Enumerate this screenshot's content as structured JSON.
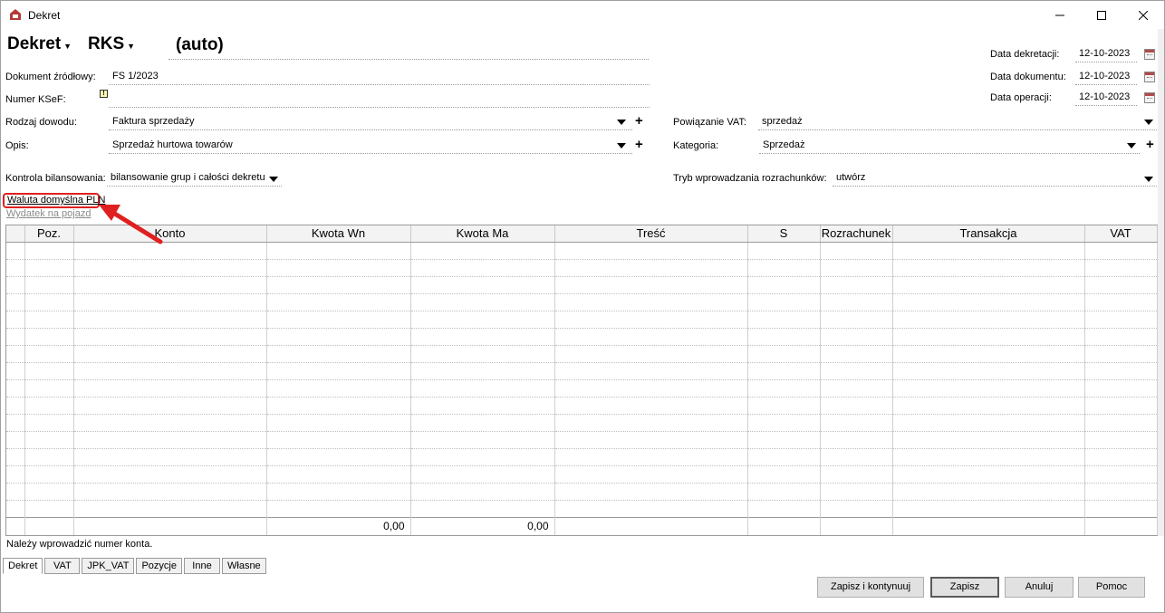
{
  "window": {
    "title": "Dekret"
  },
  "header": {
    "type_label": "Dekret",
    "register_label": "RKS",
    "number_value": "(auto)"
  },
  "dates": {
    "dekretacji_label": "Data dekretacji:",
    "dekretacji_value": "12-10-2023",
    "dokumentu_label": "Data dokumentu:",
    "dokumentu_value": "12-10-2023",
    "operacji_label": "Data operacji:",
    "operacji_value": "12-10-2023"
  },
  "fields": {
    "dokument_label": "Dokument źródłowy:",
    "dokument_value": "FS 1/2023",
    "ksef_label": "Numer KSeF:",
    "ksef_value": "",
    "rodzaj_label": "Rodzaj dowodu:",
    "rodzaj_value": "Faktura sprzedaży",
    "opis_label": "Opis:",
    "opis_value": "Sprzedaż hurtowa towarów",
    "kontrola_label": "Kontrola bilansowania:",
    "kontrola_value": "bilansowanie grup i całości dekretu",
    "powiazanie_label": "Powiązanie VAT:",
    "powiazanie_value": "sprzedaż",
    "kategoria_label": "Kategoria:",
    "kategoria_value": "Sprzedaż",
    "tryb_label": "Tryb wprowadzania rozrachunków:",
    "tryb_value": "utwórz"
  },
  "links": {
    "waluta": "Waluta domyślna PLN",
    "wydatek": "Wydatek na pojazd"
  },
  "grid": {
    "columns": [
      "Poz.",
      "Konto",
      "Kwota Wn",
      "Kwota Ma",
      "Treść",
      "S",
      "Rozrachunek",
      "Transakcja",
      "VAT"
    ],
    "total_wn": "0,00",
    "total_ma": "0,00"
  },
  "status": {
    "message": "Należy wprowadzić numer konta."
  },
  "tabs": [
    "Dekret",
    "VAT",
    "JPK_VAT",
    "Pozycje",
    "Inne",
    "Własne"
  ],
  "buttons": {
    "save_continue": "Zapisz i kontynuuj",
    "save": "Zapisz",
    "cancel": "Anuluj",
    "help": "Pomoc"
  },
  "colors": {
    "annotation": "#e02020"
  }
}
